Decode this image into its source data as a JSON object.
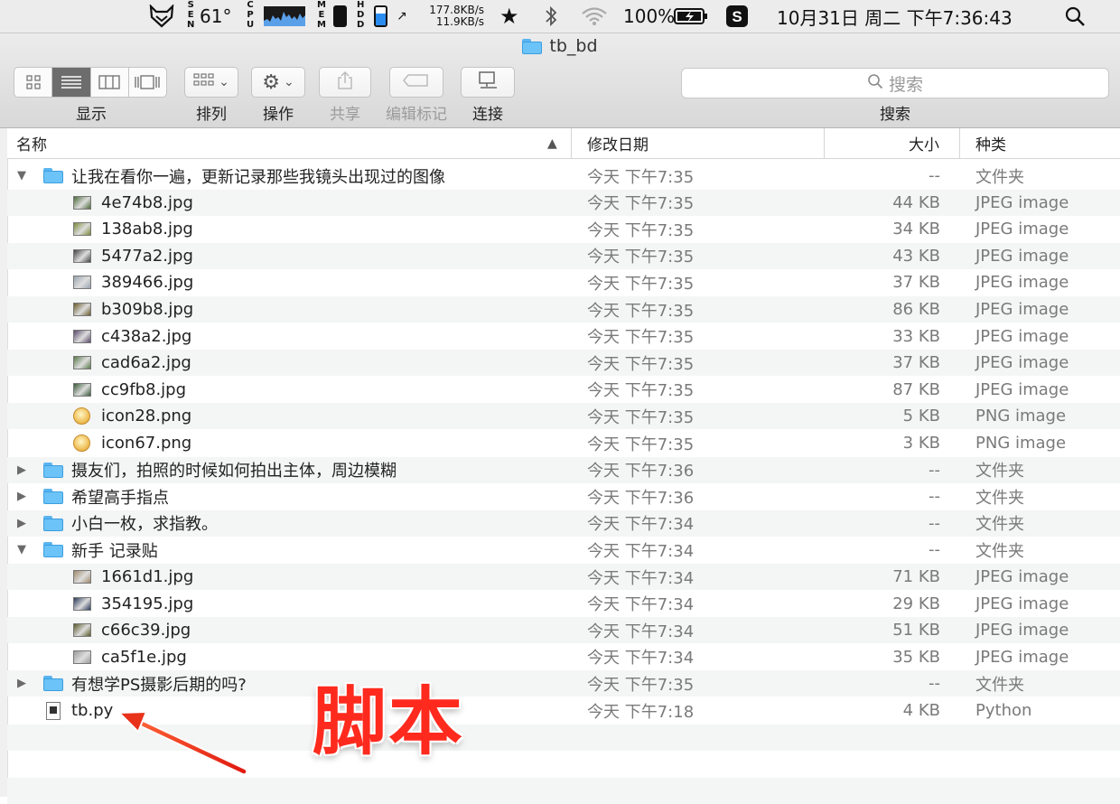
{
  "menubar": {
    "temp_label": "S\nE\nN",
    "temp": "61°",
    "cpu_label": "C\nP\nU",
    "mem_label": "M\nE\nM",
    "hd_label": "H\nD\nD",
    "net_up": "177.8KB/s",
    "net_down": "11.9KB/s",
    "battery": "100%",
    "datetime": "10月31日 周二 下午7:36:43",
    "hd_level": 0.65
  },
  "window": {
    "title": "tb_bd",
    "toolbar": {
      "view_label": "显示",
      "arrange_label": "排列",
      "action_label": "操作",
      "share_label": "共享",
      "tags_label": "编辑标记",
      "connect_label": "连接",
      "search_placeholder": "搜索",
      "search_label": "搜索"
    },
    "columns": {
      "name": "名称",
      "date": "修改日期",
      "size": "大小",
      "kind": "种类"
    }
  },
  "rows": [
    {
      "name": "让我在看你一遍，更新记录那些我镜头出现过的图像",
      "date": "今天 下午7:35",
      "size": "--",
      "kind": "文件夹",
      "icon": "folder",
      "disc": "open",
      "indent": 0
    },
    {
      "name": "4e74b8.jpg",
      "date": "今天 下午7:35",
      "size": "44 KB",
      "kind": "JPEG image",
      "icon": "image",
      "indent": 1,
      "thumb": "#4a6a3a"
    },
    {
      "name": "138ab8.jpg",
      "date": "今天 下午7:35",
      "size": "34 KB",
      "kind": "JPEG image",
      "icon": "image",
      "indent": 1,
      "thumb": "#7a8a3a"
    },
    {
      "name": "5477a2.jpg",
      "date": "今天 下午7:35",
      "size": "43 KB",
      "kind": "JPEG image",
      "icon": "image",
      "indent": 1,
      "thumb": "#444444"
    },
    {
      "name": "389466.jpg",
      "date": "今天 下午7:35",
      "size": "37 KB",
      "kind": "JPEG image",
      "icon": "image",
      "indent": 1,
      "thumb": "#9aa4b0"
    },
    {
      "name": "b309b8.jpg",
      "date": "今天 下午7:35",
      "size": "86 KB",
      "kind": "JPEG image",
      "icon": "image",
      "indent": 1,
      "thumb": "#6a5a2a"
    },
    {
      "name": "c438a2.jpg",
      "date": "今天 下午7:35",
      "size": "33 KB",
      "kind": "JPEG image",
      "icon": "image",
      "indent": 1,
      "thumb": "#5a4a6a"
    },
    {
      "name": "cad6a2.jpg",
      "date": "今天 下午7:35",
      "size": "37 KB",
      "kind": "JPEG image",
      "icon": "image",
      "indent": 1,
      "thumb": "#5a7a4a"
    },
    {
      "name": "cc9fb8.jpg",
      "date": "今天 下午7:35",
      "size": "87 KB",
      "kind": "JPEG image",
      "icon": "image",
      "indent": 1,
      "thumb": "#3a5a3a"
    },
    {
      "name": "icon28.png",
      "date": "今天 下午7:35",
      "size": "5 KB",
      "kind": "PNG image",
      "icon": "png",
      "indent": 1
    },
    {
      "name": "icon67.png",
      "date": "今天 下午7:35",
      "size": "3 KB",
      "kind": "PNG image",
      "icon": "png",
      "indent": 1
    },
    {
      "name": "摄友们，拍照的时候如何拍出主体，周边模糊",
      "date": "今天 下午7:36",
      "size": "--",
      "kind": "文件夹",
      "icon": "folder",
      "disc": "closed",
      "indent": 0
    },
    {
      "name": "希望高手指点",
      "date": "今天 下午7:36",
      "size": "--",
      "kind": "文件夹",
      "icon": "folder",
      "disc": "closed",
      "indent": 0
    },
    {
      "name": "小白一枚，求指教。",
      "date": "今天 下午7:34",
      "size": "--",
      "kind": "文件夹",
      "icon": "folder",
      "disc": "closed",
      "indent": 0
    },
    {
      "name": "新手  记录贴",
      "date": "今天 下午7:34",
      "size": "--",
      "kind": "文件夹",
      "icon": "folder",
      "disc": "open",
      "indent": 0
    },
    {
      "name": "1661d1.jpg",
      "date": "今天 下午7:34",
      "size": "71 KB",
      "kind": "JPEG image",
      "icon": "image",
      "indent": 1,
      "thumb": "#a08a6a"
    },
    {
      "name": "354195.jpg",
      "date": "今天 下午7:34",
      "size": "29 KB",
      "kind": "JPEG image",
      "icon": "image",
      "indent": 1,
      "thumb": "#2a3a5a"
    },
    {
      "name": "c66c39.jpg",
      "date": "今天 下午7:34",
      "size": "51 KB",
      "kind": "JPEG image",
      "icon": "image",
      "indent": 1,
      "thumb": "#5a5a2a"
    },
    {
      "name": "ca5f1e.jpg",
      "date": "今天 下午7:34",
      "size": "35 KB",
      "kind": "JPEG image",
      "icon": "image",
      "indent": 1,
      "thumb": "#9a9a9a"
    },
    {
      "name": "有想学PS摄影后期的吗?",
      "date": "今天 下午7:35",
      "size": "--",
      "kind": "文件夹",
      "icon": "folder",
      "disc": "closed",
      "indent": 0
    },
    {
      "name": "tb.py",
      "date": "今天 下午7:18",
      "size": "4 KB",
      "kind": "Python",
      "icon": "doc",
      "indent": 0
    }
  ],
  "annotation": {
    "text": "脚本",
    "color": "#ff2a1e"
  }
}
